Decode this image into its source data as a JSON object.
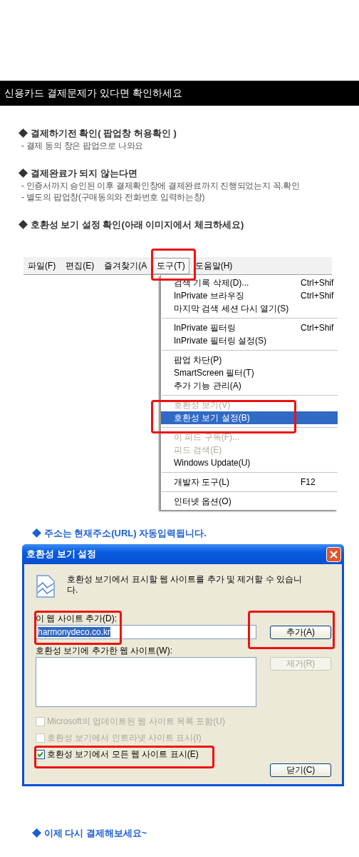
{
  "banner": {
    "title": "신용카드 결제문제가 있다면 확인하세요"
  },
  "sections": [
    {
      "heading": "◆ 결제하기전 확인( 팝업창 허용확인 )",
      "lines": [
        "- 결제 동의 창은 팝업으로 나와요"
      ]
    },
    {
      "heading": "◆ 결제완료가 되지 않는다면",
      "lines": [
        "- 인증서까지 승인된 이후 결제확인창에 결제완료까지 진행되었는지 꼭.확인",
        "- 별도의 팝업창(구매동의와 전화번호 입력하는창)"
      ]
    },
    {
      "heading": "◆ 호환성 보기 설정 확인(아래 이미지에서 체크하세요)"
    }
  ],
  "menu_screenshot": {
    "menubar": [
      {
        "label": "파일(F)",
        "selected": false
      },
      {
        "label": "편집(E)",
        "selected": false
      },
      {
        "label": "즐겨찾기(A",
        "selected": false
      },
      {
        "label": "도구(T)",
        "selected": true
      },
      {
        "label": "도움말(H)",
        "selected": false
      }
    ],
    "menu": [
      {
        "kind": "item",
        "label": "검색 기록 삭제(D)...",
        "shortcut": "Ctrl+Shif",
        "disabled": false,
        "selected": false
      },
      {
        "kind": "item",
        "label": "InPrivate 브라우징",
        "shortcut": "Ctrl+Shif",
        "disabled": false,
        "selected": false
      },
      {
        "kind": "item",
        "label": "마지막 검색 세션 다시 열기(S)",
        "disabled": false,
        "selected": false
      },
      {
        "kind": "separator"
      },
      {
        "kind": "item",
        "label": "InPrivate 필터링",
        "shortcut": "Ctrl+Shif",
        "disabled": false,
        "selected": false
      },
      {
        "kind": "item",
        "label": "InPrivate 필터링 설정(S)",
        "disabled": false,
        "selected": false
      },
      {
        "kind": "separator"
      },
      {
        "kind": "item",
        "label": "팝업 차단(P)",
        "disabled": false,
        "selected": false
      },
      {
        "kind": "item",
        "label": "SmartScreen 필터(T)",
        "disabled": false,
        "selected": false
      },
      {
        "kind": "item",
        "label": "추가 기능 관리(A)",
        "disabled": false,
        "selected": false
      },
      {
        "kind": "separator"
      },
      {
        "kind": "item",
        "label": "호환성 보기(V)",
        "disabled": true,
        "selected": false
      },
      {
        "kind": "item",
        "label": "호환성 보기 설정(B)",
        "disabled": false,
        "selected": true
      },
      {
        "kind": "separator"
      },
      {
        "kind": "item",
        "label": "이 피드 구독(F)...",
        "disabled": true,
        "selected": false
      },
      {
        "kind": "item",
        "label": "피드 검색(E)",
        "disabled": true,
        "selected": false
      },
      {
        "kind": "item",
        "label": "Windows Update(U)",
        "disabled": false,
        "selected": false
      },
      {
        "kind": "separator"
      },
      {
        "kind": "item",
        "label": "개발자 도구(L)",
        "shortcut": "F12",
        "disabled": false,
        "selected": false
      },
      {
        "kind": "separator"
      },
      {
        "kind": "item",
        "label": "인터넷 옵션(O)",
        "disabled": false,
        "selected": false
      }
    ]
  },
  "note": "◆ 주소는 현재주소(URL) 자동입력됩니다.",
  "dialog": {
    "title": "호환성 보기 설정",
    "description": "호환성 보기에서 표시할 웹 사이트를 추가 및 제거할 수 있습니다.",
    "add_label": "이 웹 사이트 추가(D):",
    "add_field": {
      "value": "harmonydeco.co.kr"
    },
    "add_button": {
      "label": "추가(A)",
      "disabled": false
    },
    "list_label": "호환성 보기에 추가한 웹 사이트(W):",
    "remove_button": {
      "label": "제거(R)",
      "disabled": true
    },
    "options": [
      {
        "label": "Microsoft의 업데이트된 웹 사이트 목록 포함(U)",
        "checked": false,
        "disabled": true
      },
      {
        "label": "호환성 보기에서 인트라넷 사이트 표시(I)",
        "checked": false,
        "disabled": true
      },
      {
        "label": "호환성 보기에서 모든 웹 사이트 표시(E)",
        "checked": true,
        "disabled": false
      }
    ],
    "close_button": {
      "label": "닫기(C)",
      "disabled": false
    }
  },
  "footer": "◆ 이제 다시 결제해보세요~"
}
